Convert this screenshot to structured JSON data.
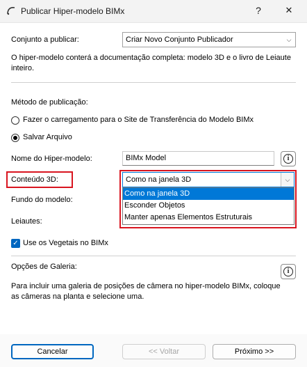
{
  "window": {
    "title": "Publicar Hiper-modelo BIMx",
    "help_label": "?",
    "close_label": "✕"
  },
  "publish_set": {
    "label": "Conjunto a publicar:",
    "value": "Criar Novo Conjunto Publicador",
    "description": "O hiper-modelo conterá a documentação completa: modelo 3D e o livro de Leiaute inteiro."
  },
  "method": {
    "label": "Método de publicação:",
    "options": [
      {
        "label": "Fazer o carregamento para o Site de Transferência do Modelo BIMx",
        "selected": false
      },
      {
        "label": "Salvar Arquivo",
        "selected": true
      }
    ]
  },
  "model_name": {
    "label": "Nome do Hiper-modelo:",
    "value": "BIMx Model"
  },
  "content3d": {
    "label": "Conteúdo 3D:",
    "value": "Como na janela 3D",
    "options": [
      "Como na janela 3D",
      "Esconder Objetos",
      "Manter apenas Elementos Estruturais"
    ],
    "selected_index": 0
  },
  "background": {
    "label": "Fundo do modelo:"
  },
  "layouts": {
    "label": "Leiautes:"
  },
  "vegetation": {
    "label": "Use os Vegetais no BIMx",
    "checked": true
  },
  "gallery": {
    "label": "Opções de Galeria:",
    "description": "Para incluir uma galeria de posições de câmera no hiper-modelo BIMx, coloque as câmeras na planta e selecione uma."
  },
  "buttons": {
    "cancel": "Cancelar",
    "back": "<< Voltar",
    "next": "Próximo >>"
  },
  "colors": {
    "accent": "#0067c0",
    "highlight_box": "#d9141f",
    "selection": "#0078d7"
  }
}
